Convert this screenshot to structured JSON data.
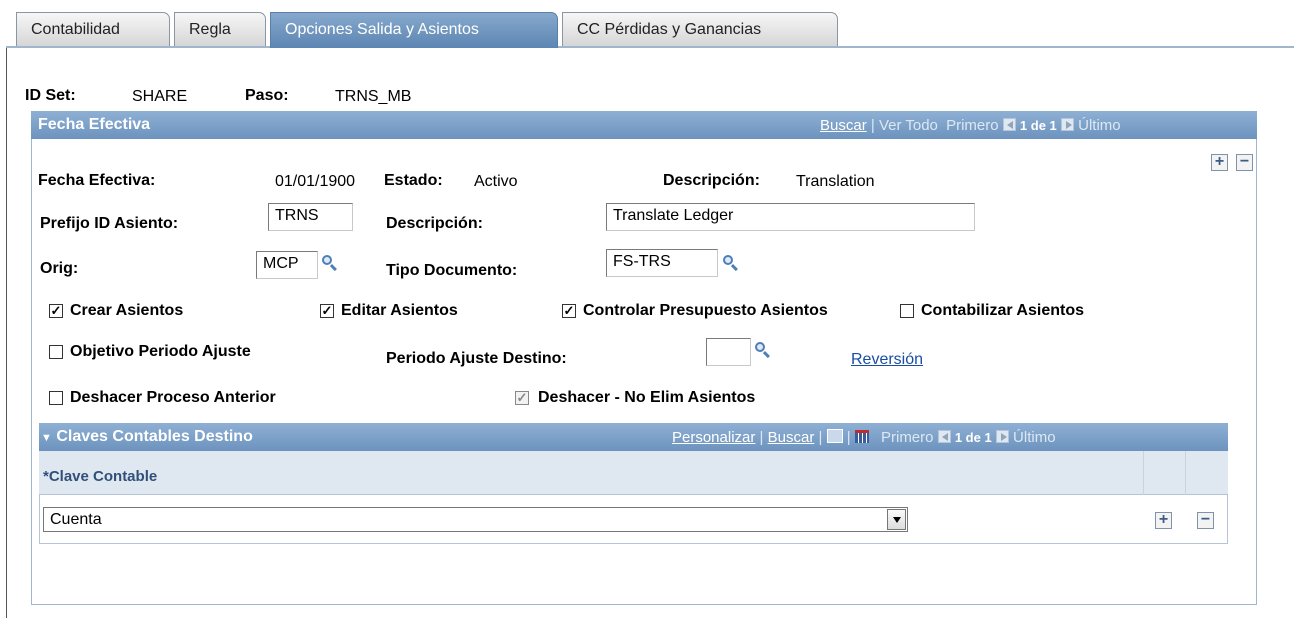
{
  "tabs": [
    {
      "label": "Contabilidad"
    },
    {
      "label": "Regla"
    },
    {
      "label": "Opciones Salida y Asientos"
    },
    {
      "label": "CC Pérdidas y Ganancias"
    }
  ],
  "header": {
    "id_set_label": "ID Set:",
    "id_set_value": "SHARE",
    "paso_label": "Paso:",
    "paso_value": "TRNS_MB"
  },
  "fecha_efectiva_box": {
    "title": "Fecha Efectiva",
    "nav": {
      "buscar": "Buscar",
      "ver_todo": "Ver Todo",
      "primero": "Primero",
      "count": "1 de 1",
      "ultimo": "Último"
    },
    "fecha_efectiva_label": "Fecha Efectiva:",
    "fecha_efectiva_value": "01/01/1900",
    "estado_label": "Estado:",
    "estado_value": "Activo",
    "descripcion_label": "Descripción:",
    "descripcion_value": "Translation",
    "prefijo_label": "Prefijo ID Asiento:",
    "prefijo_value": "TRNS",
    "descripcion2_label": "Descripción:",
    "descripcion2_value": "Translate Ledger",
    "orig_label": "Orig:",
    "orig_value": "MCP",
    "tipo_doc_label": "Tipo Documento:",
    "tipo_doc_value": "FS-TRS",
    "checkboxes": {
      "crear": {
        "label": "Crear Asientos",
        "checked": true
      },
      "editar": {
        "label": "Editar Asientos",
        "checked": true
      },
      "controlar": {
        "label": "Controlar Presupuesto Asientos",
        "checked": true
      },
      "contabilizar": {
        "label": "Contabilizar Asientos",
        "checked": false
      },
      "objetivo": {
        "label": "Objetivo Periodo Ajuste",
        "checked": false
      },
      "deshacer": {
        "label": "Deshacer Proceso Anterior",
        "checked": false
      },
      "deshacer_no_elim": {
        "label": "Deshacer - No Elim Asientos",
        "checked": true,
        "disabled": true
      }
    },
    "periodo_ajuste_label": "Periodo Ajuste Destino:",
    "periodo_ajuste_value": "",
    "reversion_link": "Reversión"
  },
  "claves_grid": {
    "title": "Claves Contables Destino",
    "nav": {
      "personalizar": "Personalizar",
      "buscar": "Buscar",
      "primero": "Primero",
      "count": "1 de 1",
      "ultimo": "Último"
    },
    "column_header": "*Clave Contable",
    "rows": [
      {
        "clave": "Cuenta"
      }
    ]
  },
  "colors": {
    "header_blue": "#6c93be",
    "link_blue": "#1a4ea3",
    "grid_header_bg": "#dfe7f0"
  }
}
